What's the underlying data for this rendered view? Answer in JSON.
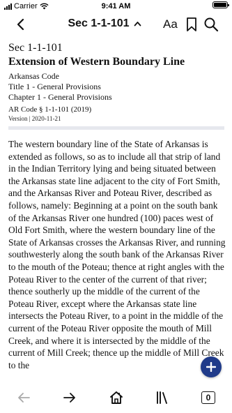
{
  "status_bar": {
    "carrier": "Carrier",
    "time": "9:41 AM"
  },
  "nav": {
    "title": "Sec 1-1-101",
    "font_button": "Aa",
    "icons": [
      "back-chevron-icon",
      "chevron-up-icon",
      "bookmark-icon",
      "search-icon"
    ]
  },
  "section": {
    "number": "Sec 1-1-101",
    "heading": "Extension of Western Boundary Line",
    "code": "Arkansas Code",
    "title": "Title 1 - General Provisions",
    "chapter": "Chapter 1 - General Provisions",
    "code_ref": "AR Code § 1-1-101 (2019)",
    "version": "Version | 2020-11-21",
    "body": "The western boundary line of the State of Arkansas is extended as follows, so as to include all that strip of land in the Indian Territory lying and being situated between the Arkansas state line adjacent to the city of Fort Smith, and the Arkansas River and Poteau River, described as follows, namely: Beginning at a point on the south bank of the Arkansas River one hundred (100) paces west of Old Fort Smith, where the western boundary line of the State of Arkansas crosses the Arkansas River, and running southwesterly along the south bank of the Arkansas River to the mouth of the Poteau; thence at right angles with the Poteau River to the center of the current of that river; thence southerly up the middle of the current of the Poteau River, except where the Arkansas state line intersects the Poteau River, to a point in the middle of the current of the Poteau River opposite the mouth of Mill Creek, and where it is intersected by the middle of the current of Mill Creek; thence up the middle of Mill Creek to the"
  },
  "fab": {
    "icon": "plus-icon"
  },
  "bottom_bar": {
    "icons": [
      "arrow-left-icon",
      "arrow-right-icon",
      "home-icon",
      "library-icon"
    ],
    "tabs_count": "0"
  },
  "colors": {
    "accent": "#203b8a",
    "divider": "#e6e8ee",
    "disabled": "#a9a9a9"
  }
}
